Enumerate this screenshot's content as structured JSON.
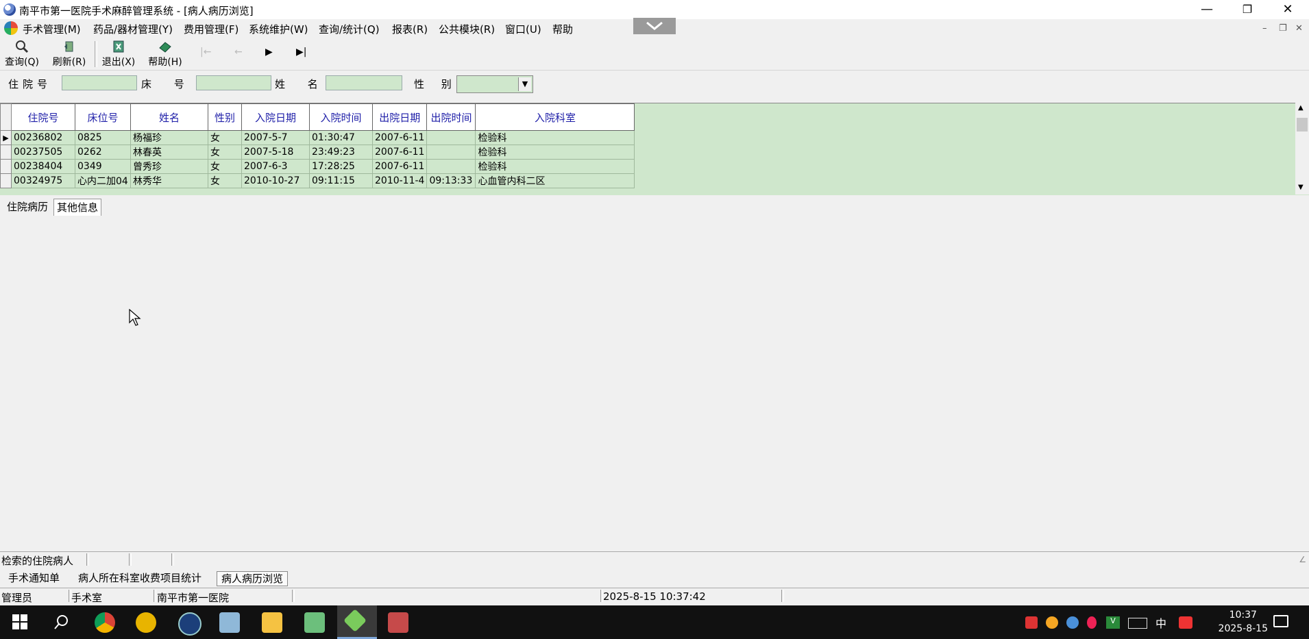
{
  "window": {
    "title": "南平市第一医院手术麻醉管理系统 - [病人病历浏览]"
  },
  "menu": [
    "手术管理(M)",
    "药品/器材管理(Y)",
    "费用管理(F)",
    "系统维护(W)",
    "查询/统计(Q)",
    "报表(R)",
    "公共模块(R)",
    "窗口(U)",
    "帮助"
  ],
  "toolbar": {
    "query": "查询(Q)",
    "refresh": "刷新(R)",
    "exit": "退出(X)",
    "help": "帮助(H)"
  },
  "search": {
    "inpatient_label": "住院号",
    "bed_label": "床 号",
    "name_label": "姓 名",
    "sex_label": "性 别"
  },
  "grid": {
    "columns": [
      "住院号",
      "床位号",
      "姓名",
      "性别",
      "入院日期",
      "入院时间",
      "出院日期",
      "出院时间",
      "入院科室"
    ],
    "rows": [
      [
        "00236802",
        "0825",
        "杨福珍",
        "女",
        "2007-5-7",
        "01:30:47",
        "2007-6-11",
        "",
        "检验科"
      ],
      [
        "00237505",
        "0262",
        "林春英",
        "女",
        "2007-5-18",
        "23:49:23",
        "2007-6-11",
        "",
        "检验科"
      ],
      [
        "00238404",
        "0349",
        "曾秀珍",
        "女",
        "2007-6-3",
        "17:28:25",
        "2007-6-11",
        "",
        "检验科"
      ],
      [
        "00324975",
        "心内二加04",
        "林秀华",
        "女",
        "2010-10-27",
        "09:11:15",
        "2010-11-4",
        "09:13:33",
        "心血管内科二区"
      ]
    ]
  },
  "tabs": [
    "住院病历",
    "其他信息"
  ],
  "status": {
    "text": "检索的住院病人"
  },
  "window_tabs": [
    "手术通知单",
    "病人所在科室收费项目统计",
    "病人病历浏览"
  ],
  "statusbar": {
    "user": "管理员",
    "dept": "手术室",
    "hospital": "南平市第一医院",
    "datetime": "2025-8-15 10:37:42"
  },
  "taskbar": {
    "time": "10:37",
    "date": "2025-8-15",
    "ime": "中"
  }
}
